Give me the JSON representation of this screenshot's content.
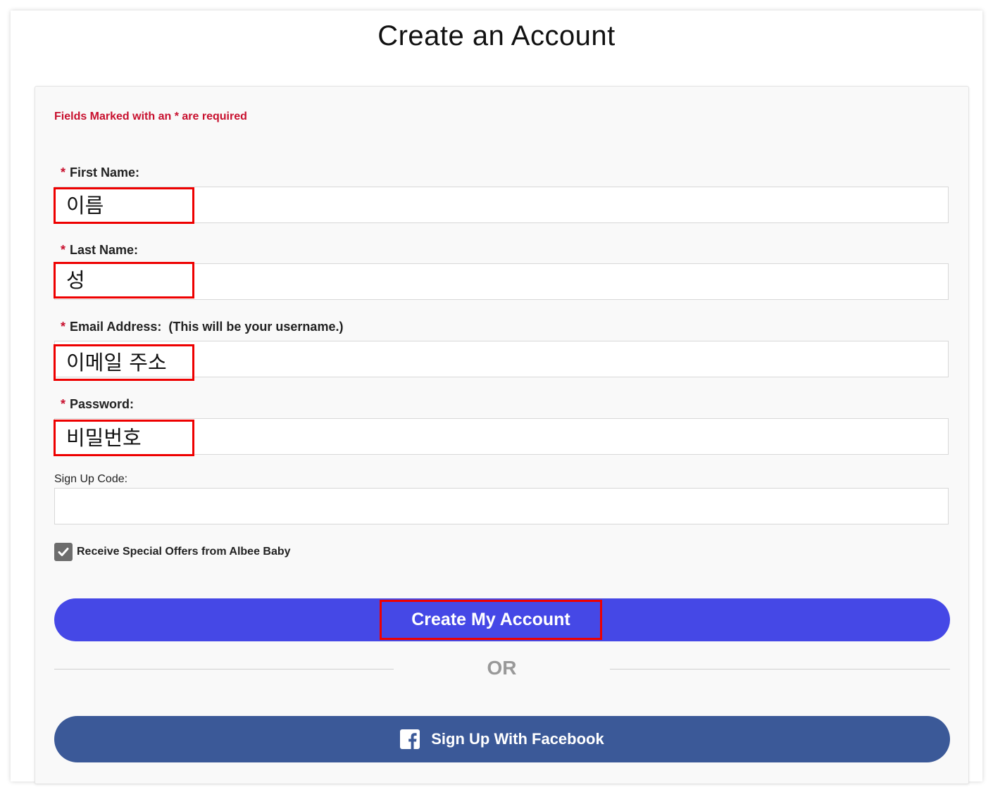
{
  "page_title": "Create an Account",
  "required_note": "Fields Marked with an * are required",
  "fields": {
    "first_name": {
      "star": "*",
      "label": "First Name:",
      "value": "이름"
    },
    "last_name": {
      "star": "*",
      "label": "Last Name:",
      "value": "성"
    },
    "email": {
      "star": "*",
      "label": "Email Address:  (This will be your username.)",
      "value": "이메일 주소"
    },
    "password": {
      "star": "*",
      "label": "Password:",
      "value": "비밀번호"
    },
    "signup_code": {
      "label": "Sign Up Code:",
      "value": ""
    }
  },
  "offers_checkbox": {
    "checked": true,
    "label": "Receive Special Offers from Albee Baby"
  },
  "create_button": {
    "label": "Create My Account",
    "color": "#4548e6"
  },
  "or_text": "OR",
  "facebook_button": {
    "label": "Sign Up With Facebook",
    "icon": "facebook-icon",
    "color": "#3b5998"
  },
  "colors": {
    "required": "#c8102e",
    "annotation": "#ee0000"
  }
}
